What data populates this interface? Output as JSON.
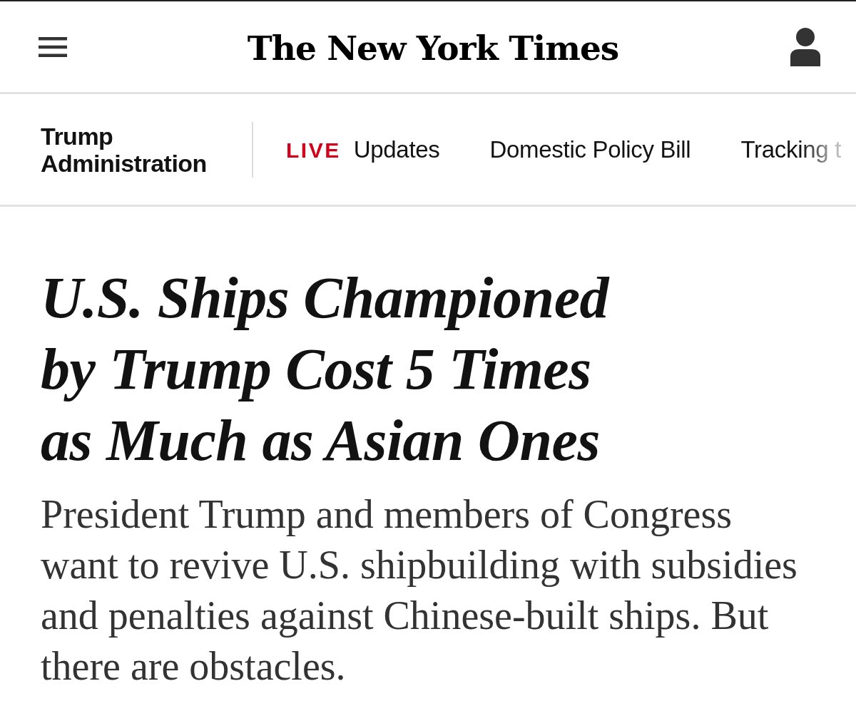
{
  "header": {
    "logo": "The New York Times"
  },
  "section_nav": {
    "section": "Trump Administration",
    "links": [
      {
        "kind": "live",
        "badge": "LIVE",
        "label": "Updates"
      },
      {
        "kind": "plain",
        "label": "Domestic Policy Bill"
      },
      {
        "kind": "faded",
        "label": "Tracking t"
      }
    ]
  },
  "article": {
    "headline": "U.S. Ships Championed by Trump Cost 5 Times as Much as Asian Ones",
    "summary": "President Trump and members of Congress want to revive U.S. shipbuilding with subsidies and penalties against Chinese-built ships. But there are obstacles."
  }
}
